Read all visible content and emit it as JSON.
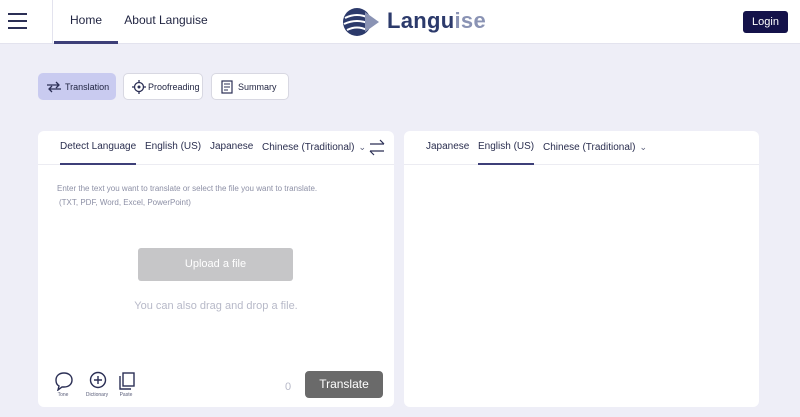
{
  "header": {
    "nav": [
      {
        "label": "Home",
        "active": true
      },
      {
        "label": "About Languise",
        "active": false
      }
    ],
    "logo": {
      "part1": "Langu",
      "part2": "ise"
    },
    "login_label": "Login",
    "accent_color": "#14124a"
  },
  "modes": [
    {
      "label": "Translation",
      "icon": "translate-arrows-icon",
      "active": true
    },
    {
      "label": "Proofreading",
      "icon": "crosshair-icon",
      "active": false
    },
    {
      "label": "Summary",
      "icon": "document-icon",
      "active": false
    }
  ],
  "source": {
    "languages": [
      {
        "label": "Detect Language",
        "active": true
      },
      {
        "label": "English (US)",
        "active": false
      },
      {
        "label": "Japanese",
        "active": false
      },
      {
        "label": "Chinese (Traditional)",
        "active": false
      }
    ],
    "hint_line1": "Enter the text you want to translate or select the file you want to translate.",
    "hint_line2": "(TXT, PDF, Word, Excel, PowerPoint)",
    "upload_label": "Upload a file",
    "drag_label": "You can also drag and drop a file.",
    "tools": [
      {
        "label": "Tone",
        "icon": "speech-bubble-icon"
      },
      {
        "label": "Dictionary",
        "icon": "plus-circle-icon"
      },
      {
        "label": "Paste",
        "icon": "paste-icon"
      }
    ],
    "char_count": "0",
    "translate_label": "Translate"
  },
  "target": {
    "languages": [
      {
        "label": "Japanese",
        "active": false
      },
      {
        "label": "English (US)",
        "active": true
      },
      {
        "label": "Chinese (Traditional)",
        "active": false
      }
    ]
  }
}
